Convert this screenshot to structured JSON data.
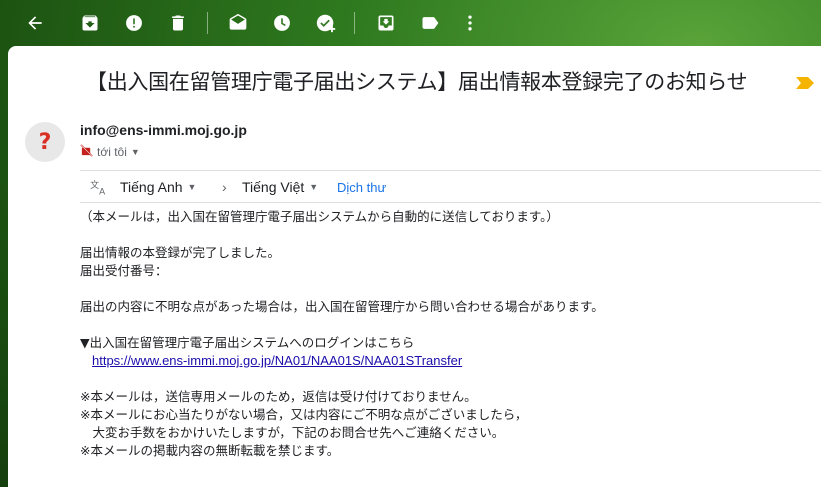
{
  "toolbar": {
    "icons": [
      "back-arrow-icon",
      "archive-icon",
      "report-spam-icon",
      "delete-icon",
      "mark-unread-icon",
      "snooze-icon",
      "add-to-tasks-icon",
      "move-to-icon",
      "label-icon",
      "more-icon"
    ]
  },
  "email": {
    "subject": "【出入国在留管理庁電子届出システム】届出情報本登録完了のお知らせ",
    "sender": "info@ens-immi.moj.go.jp",
    "avatar_glyph": "?",
    "recipient": "tới tôi"
  },
  "translate": {
    "source_lang": "Tiếng Anh",
    "target_lang": "Tiếng Việt",
    "translate_link": "Dịch thư"
  },
  "body": {
    "line1": "（本メールは，出入国在留管理庁電子届出システムから自動的に送信しております。）",
    "line2": "届出情報の本登録が完了しました。",
    "line3": "届出受付番号：",
    "line4": "届出の内容に不明な点があった場合は，出入国在留管理庁から問い合わせる場合があります。",
    "line5": "▼出入国在留管理庁電子届出システムへのログインはこちら",
    "link": "https://www.ens-immi.moj.go.jp/NA01/NAA01S/NAA01STransfer",
    "line6": "※本メールは，送信専用メールのため，返信は受け付けておりません。",
    "line7": "※本メールにお心当たりがない場合，又は内容にご不明な点がございましたら，",
    "line8": "　大変お手数をおかけいたしますが，下記のお問合せ先へご連絡ください。",
    "line9": "※本メールの掲載内容の無断転載を禁じます。"
  },
  "colors": {
    "link": "#1a0dab",
    "translate_link": "#1a73e8",
    "important_marker": "#f4b400",
    "avatar_question": "#d93025"
  }
}
